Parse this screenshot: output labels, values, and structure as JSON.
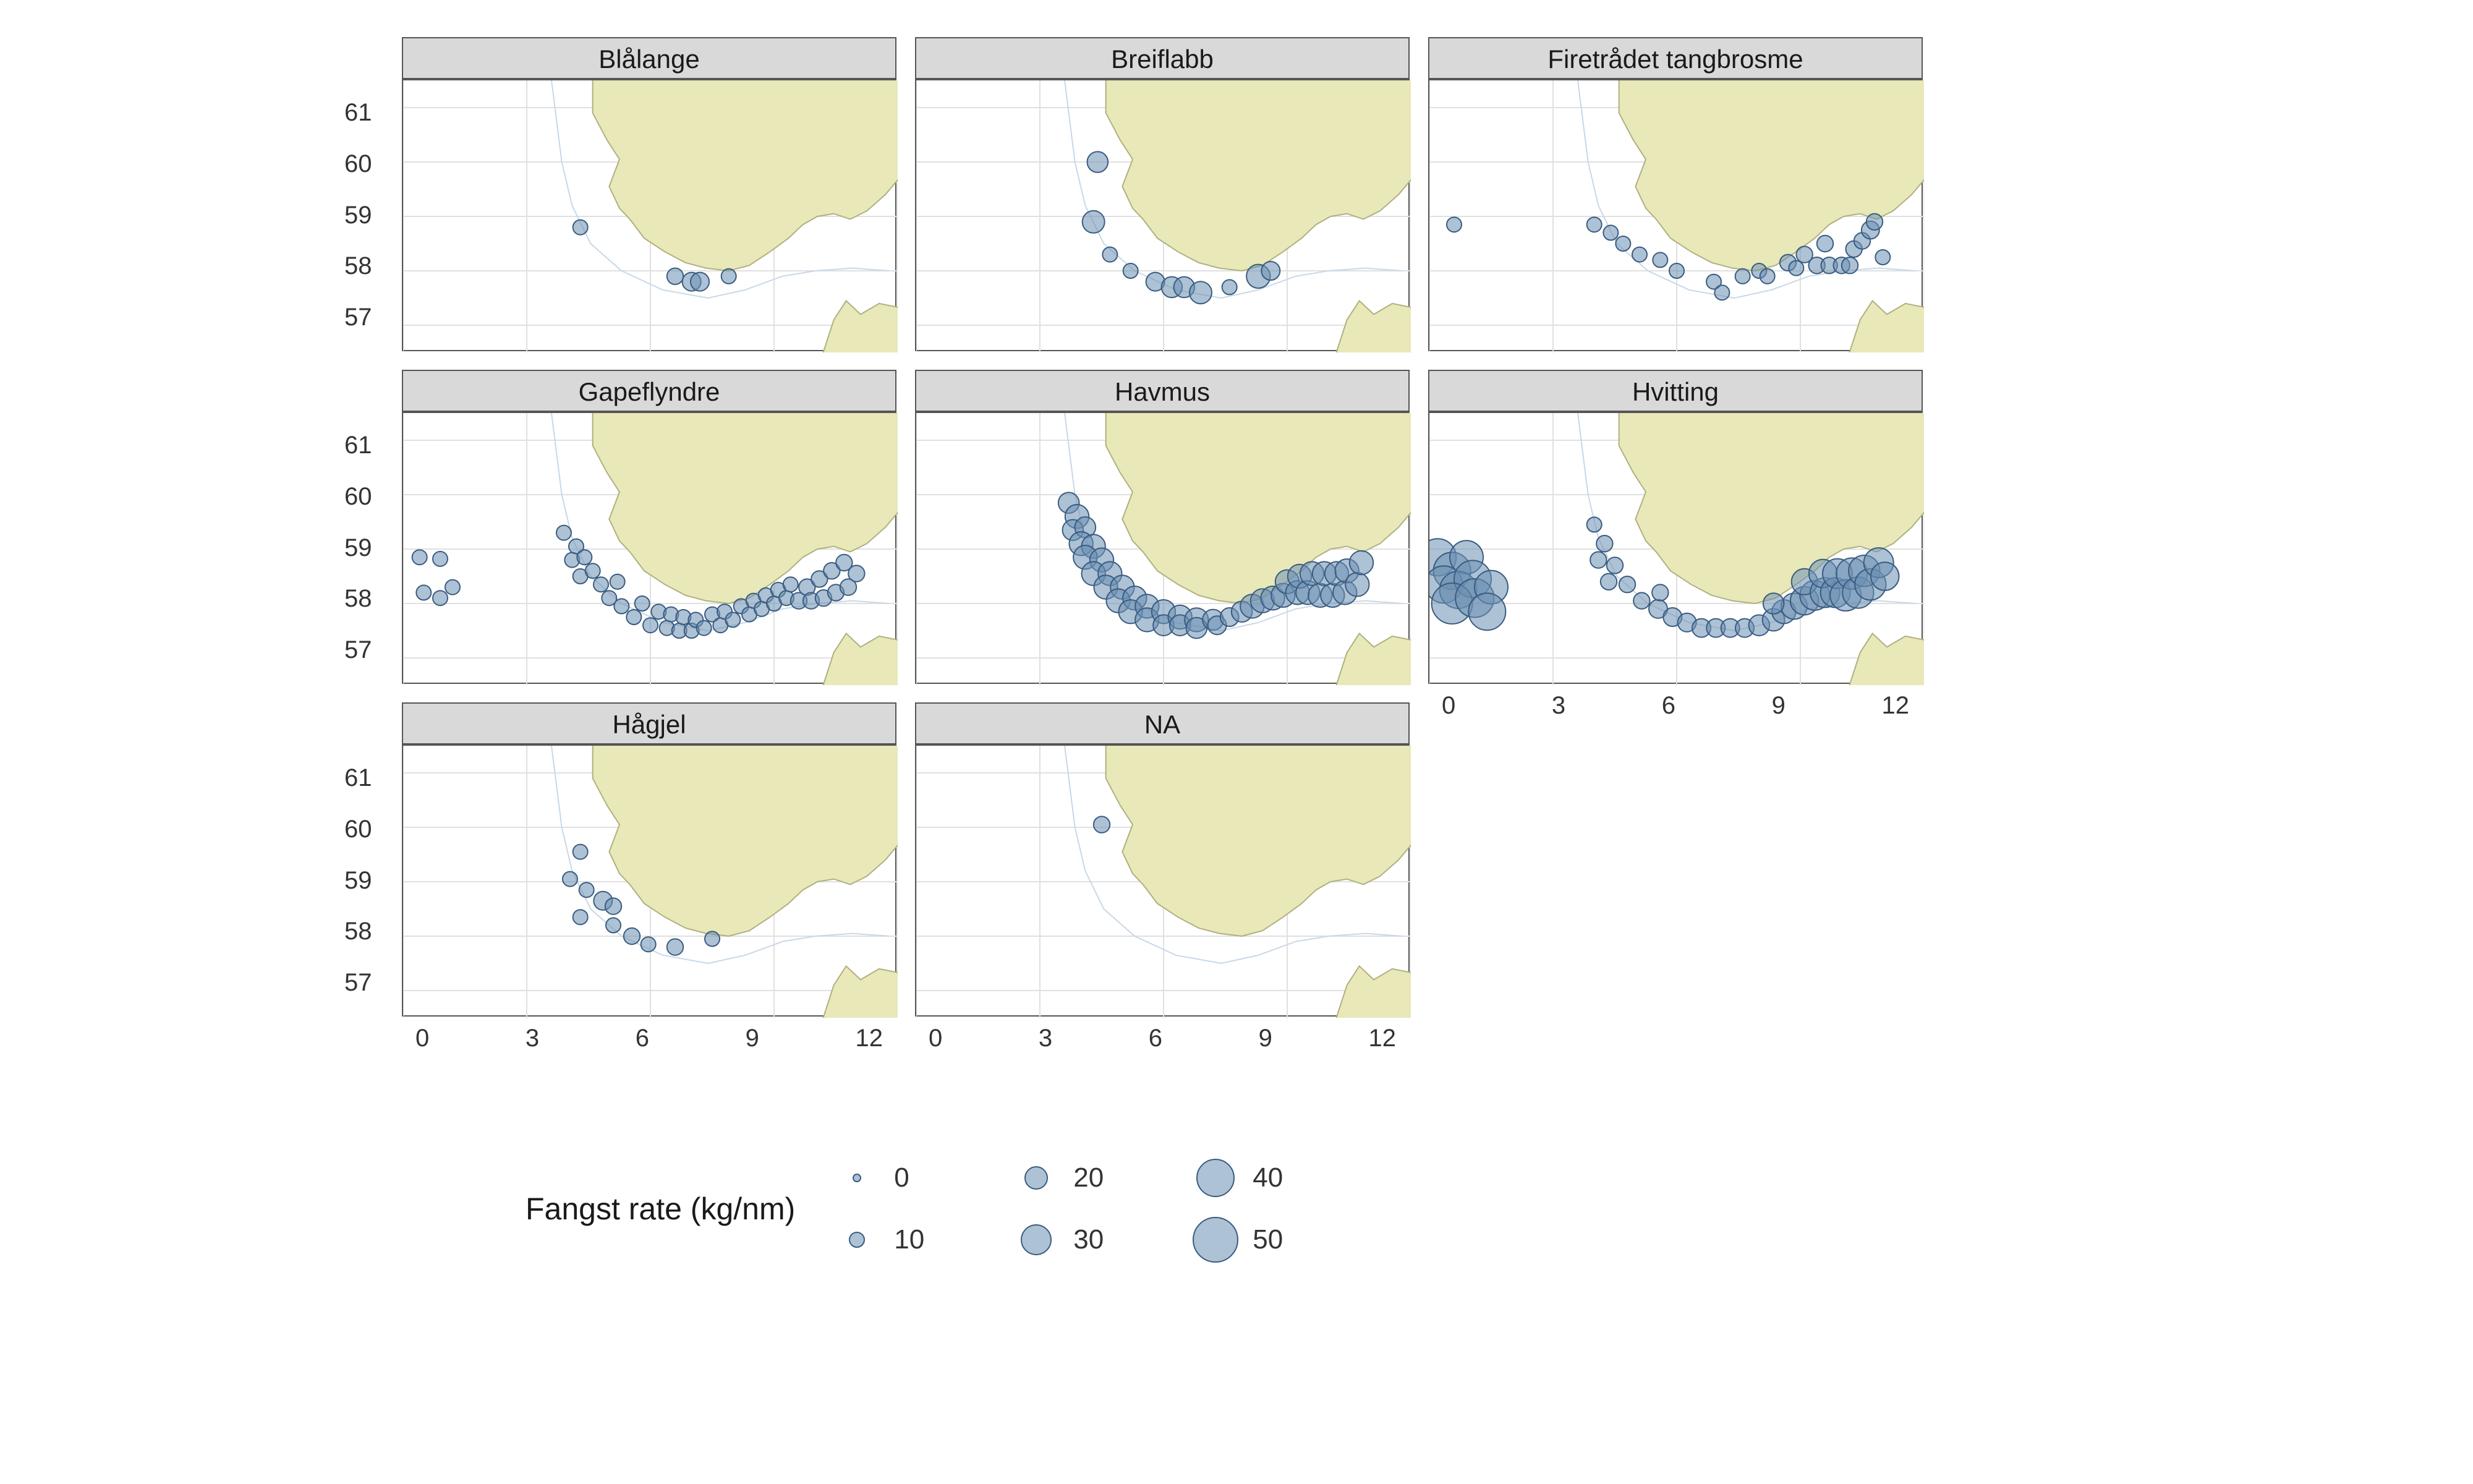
{
  "chart_data": {
    "type": "scatter",
    "legend_title": "Fangst rate (kg/nm)",
    "legend_values": [
      0,
      10,
      20,
      30,
      40,
      50
    ],
    "xlim": [
      0,
      12
    ],
    "ylim": [
      56.5,
      61.5
    ],
    "x_ticks": [
      0,
      3,
      6,
      9,
      12
    ],
    "y_ticks": [
      57,
      58,
      59,
      60,
      61
    ],
    "facets": [
      {
        "name": "Blålange",
        "points": [
          {
            "x": 4.3,
            "y": 58.8,
            "r": 10
          },
          {
            "x": 6.6,
            "y": 57.9,
            "r": 12
          },
          {
            "x": 7.0,
            "y": 57.8,
            "r": 15
          },
          {
            "x": 7.2,
            "y": 57.8,
            "r": 15
          },
          {
            "x": 7.9,
            "y": 57.9,
            "r": 10
          }
        ]
      },
      {
        "name": "Breiflabb",
        "points": [
          {
            "x": 4.4,
            "y": 60.0,
            "r": 18
          },
          {
            "x": 4.3,
            "y": 58.9,
            "r": 20
          },
          {
            "x": 4.7,
            "y": 58.3,
            "r": 10
          },
          {
            "x": 5.2,
            "y": 58.0,
            "r": 10
          },
          {
            "x": 5.8,
            "y": 57.8,
            "r": 15
          },
          {
            "x": 6.2,
            "y": 57.7,
            "r": 18
          },
          {
            "x": 6.5,
            "y": 57.7,
            "r": 18
          },
          {
            "x": 6.9,
            "y": 57.6,
            "r": 20
          },
          {
            "x": 7.6,
            "y": 57.7,
            "r": 10
          },
          {
            "x": 8.3,
            "y": 57.9,
            "r": 22
          },
          {
            "x": 8.6,
            "y": 58.0,
            "r": 15
          }
        ]
      },
      {
        "name": "Firetrådet tangbrosme",
        "points": [
          {
            "x": 0.6,
            "y": 58.85,
            "r": 10
          },
          {
            "x": 4.0,
            "y": 58.85,
            "r": 10
          },
          {
            "x": 4.4,
            "y": 58.7,
            "r": 10
          },
          {
            "x": 4.7,
            "y": 58.5,
            "r": 10
          },
          {
            "x": 5.1,
            "y": 58.3,
            "r": 10
          },
          {
            "x": 5.6,
            "y": 58.2,
            "r": 10
          },
          {
            "x": 6.0,
            "y": 58.0,
            "r": 10
          },
          {
            "x": 6.9,
            "y": 57.8,
            "r": 10
          },
          {
            "x": 7.1,
            "y": 57.6,
            "r": 10
          },
          {
            "x": 7.6,
            "y": 57.9,
            "r": 10
          },
          {
            "x": 8.0,
            "y": 58.0,
            "r": 10
          },
          {
            "x": 8.2,
            "y": 57.9,
            "r": 10
          },
          {
            "x": 8.7,
            "y": 58.15,
            "r": 12
          },
          {
            "x": 8.9,
            "y": 58.05,
            "r": 10
          },
          {
            "x": 9.1,
            "y": 58.3,
            "r": 12
          },
          {
            "x": 9.4,
            "y": 58.1,
            "r": 12
          },
          {
            "x": 9.6,
            "y": 58.5,
            "r": 12
          },
          {
            "x": 9.7,
            "y": 58.1,
            "r": 12
          },
          {
            "x": 10.0,
            "y": 58.1,
            "r": 12
          },
          {
            "x": 10.2,
            "y": 58.1,
            "r": 12
          },
          {
            "x": 10.3,
            "y": 58.4,
            "r": 12
          },
          {
            "x": 10.5,
            "y": 58.55,
            "r": 12
          },
          {
            "x": 10.7,
            "y": 58.75,
            "r": 14
          },
          {
            "x": 10.8,
            "y": 58.9,
            "r": 12
          },
          {
            "x": 11.0,
            "y": 58.25,
            "r": 10
          }
        ]
      },
      {
        "name": "Gapeflyndre",
        "points": [
          {
            "x": 0.4,
            "y": 58.85,
            "r": 10
          },
          {
            "x": 0.9,
            "y": 58.82,
            "r": 10
          },
          {
            "x": 0.5,
            "y": 58.2,
            "r": 10
          },
          {
            "x": 0.9,
            "y": 58.1,
            "r": 10
          },
          {
            "x": 1.2,
            "y": 58.3,
            "r": 10
          },
          {
            "x": 3.9,
            "y": 59.3,
            "r": 10
          },
          {
            "x": 4.2,
            "y": 59.05,
            "r": 10
          },
          {
            "x": 4.1,
            "y": 58.8,
            "r": 10
          },
          {
            "x": 4.4,
            "y": 58.85,
            "r": 10
          },
          {
            "x": 4.3,
            "y": 58.5,
            "r": 10
          },
          {
            "x": 4.6,
            "y": 58.6,
            "r": 10
          },
          {
            "x": 4.8,
            "y": 58.35,
            "r": 10
          },
          {
            "x": 5.0,
            "y": 58.1,
            "r": 10
          },
          {
            "x": 5.2,
            "y": 58.4,
            "r": 10
          },
          {
            "x": 5.3,
            "y": 57.95,
            "r": 10
          },
          {
            "x": 5.6,
            "y": 57.75,
            "r": 10
          },
          {
            "x": 5.8,
            "y": 58.0,
            "r": 10
          },
          {
            "x": 6.0,
            "y": 57.6,
            "r": 10
          },
          {
            "x": 6.2,
            "y": 57.85,
            "r": 10
          },
          {
            "x": 6.4,
            "y": 57.55,
            "r": 10
          },
          {
            "x": 6.5,
            "y": 57.8,
            "r": 10
          },
          {
            "x": 6.7,
            "y": 57.5,
            "r": 10
          },
          {
            "x": 6.8,
            "y": 57.75,
            "r": 10
          },
          {
            "x": 7.0,
            "y": 57.5,
            "r": 10
          },
          {
            "x": 7.1,
            "y": 57.7,
            "r": 10
          },
          {
            "x": 7.3,
            "y": 57.55,
            "r": 10
          },
          {
            "x": 7.5,
            "y": 57.8,
            "r": 10
          },
          {
            "x": 7.7,
            "y": 57.6,
            "r": 10
          },
          {
            "x": 7.8,
            "y": 57.85,
            "r": 10
          },
          {
            "x": 8.0,
            "y": 57.7,
            "r": 10
          },
          {
            "x": 8.2,
            "y": 57.95,
            "r": 10
          },
          {
            "x": 8.4,
            "y": 57.8,
            "r": 10
          },
          {
            "x": 8.5,
            "y": 58.05,
            "r": 10
          },
          {
            "x": 8.7,
            "y": 57.9,
            "r": 10
          },
          {
            "x": 8.8,
            "y": 58.15,
            "r": 10
          },
          {
            "x": 9.0,
            "y": 58.0,
            "r": 10
          },
          {
            "x": 9.1,
            "y": 58.25,
            "r": 10
          },
          {
            "x": 9.3,
            "y": 58.1,
            "r": 10
          },
          {
            "x": 9.4,
            "y": 58.35,
            "r": 10
          },
          {
            "x": 9.6,
            "y": 58.05,
            "r": 12
          },
          {
            "x": 9.8,
            "y": 58.3,
            "r": 12
          },
          {
            "x": 9.9,
            "y": 58.05,
            "r": 12
          },
          {
            "x": 10.1,
            "y": 58.45,
            "r": 12
          },
          {
            "x": 10.2,
            "y": 58.1,
            "r": 12
          },
          {
            "x": 10.4,
            "y": 58.6,
            "r": 12
          },
          {
            "x": 10.5,
            "y": 58.2,
            "r": 12
          },
          {
            "x": 10.7,
            "y": 58.75,
            "r": 12
          },
          {
            "x": 10.8,
            "y": 58.3,
            "r": 12
          },
          {
            "x": 11.0,
            "y": 58.55,
            "r": 12
          }
        ]
      },
      {
        "name": "Havmus",
        "points": [
          {
            "x": 3.7,
            "y": 59.85,
            "r": 18
          },
          {
            "x": 3.9,
            "y": 59.6,
            "r": 22
          },
          {
            "x": 3.8,
            "y": 59.35,
            "r": 18
          },
          {
            "x": 4.1,
            "y": 59.4,
            "r": 18
          },
          {
            "x": 4.0,
            "y": 59.1,
            "r": 22
          },
          {
            "x": 4.3,
            "y": 59.05,
            "r": 22
          },
          {
            "x": 4.1,
            "y": 58.85,
            "r": 22
          },
          {
            "x": 4.5,
            "y": 58.8,
            "r": 22
          },
          {
            "x": 4.3,
            "y": 58.55,
            "r": 22
          },
          {
            "x": 4.7,
            "y": 58.55,
            "r": 22
          },
          {
            "x": 4.6,
            "y": 58.3,
            "r": 22
          },
          {
            "x": 5.0,
            "y": 58.3,
            "r": 22
          },
          {
            "x": 4.9,
            "y": 58.05,
            "r": 22
          },
          {
            "x": 5.3,
            "y": 58.1,
            "r": 22
          },
          {
            "x": 5.2,
            "y": 57.85,
            "r": 22
          },
          {
            "x": 5.6,
            "y": 57.95,
            "r": 22
          },
          {
            "x": 5.6,
            "y": 57.7,
            "r": 22
          },
          {
            "x": 6.0,
            "y": 57.85,
            "r": 22
          },
          {
            "x": 6.0,
            "y": 57.6,
            "r": 18
          },
          {
            "x": 6.4,
            "y": 57.75,
            "r": 22
          },
          {
            "x": 6.4,
            "y": 57.6,
            "r": 18
          },
          {
            "x": 6.8,
            "y": 57.7,
            "r": 22
          },
          {
            "x": 6.8,
            "y": 57.55,
            "r": 18
          },
          {
            "x": 7.2,
            "y": 57.7,
            "r": 18
          },
          {
            "x": 7.3,
            "y": 57.6,
            "r": 15
          },
          {
            "x": 7.6,
            "y": 57.75,
            "r": 15
          },
          {
            "x": 7.9,
            "y": 57.85,
            "r": 18
          },
          {
            "x": 8.15,
            "y": 57.95,
            "r": 22
          },
          {
            "x": 8.4,
            "y": 58.05,
            "r": 22
          },
          {
            "x": 8.65,
            "y": 58.1,
            "r": 22
          },
          {
            "x": 8.9,
            "y": 58.15,
            "r": 22
          },
          {
            "x": 9.0,
            "y": 58.4,
            "r": 22
          },
          {
            "x": 9.25,
            "y": 58.2,
            "r": 22
          },
          {
            "x": 9.3,
            "y": 58.5,
            "r": 22
          },
          {
            "x": 9.5,
            "y": 58.2,
            "r": 22
          },
          {
            "x": 9.6,
            "y": 58.55,
            "r": 22
          },
          {
            "x": 9.8,
            "y": 58.15,
            "r": 22
          },
          {
            "x": 9.9,
            "y": 58.55,
            "r": 22
          },
          {
            "x": 10.1,
            "y": 58.15,
            "r": 22
          },
          {
            "x": 10.2,
            "y": 58.55,
            "r": 22
          },
          {
            "x": 10.4,
            "y": 58.2,
            "r": 22
          },
          {
            "x": 10.45,
            "y": 58.6,
            "r": 22
          },
          {
            "x": 10.7,
            "y": 58.35,
            "r": 22
          },
          {
            "x": 10.8,
            "y": 58.75,
            "r": 22
          }
        ]
      },
      {
        "name": "Hvitting",
        "points": [
          {
            "x": 0.2,
            "y": 58.85,
            "r": 40
          },
          {
            "x": 0.55,
            "y": 58.6,
            "r": 40
          },
          {
            "x": 0.9,
            "y": 58.85,
            "r": 35
          },
          {
            "x": 0.35,
            "y": 58.35,
            "r": 40
          },
          {
            "x": 0.7,
            "y": 58.25,
            "r": 40
          },
          {
            "x": 1.05,
            "y": 58.45,
            "r": 40
          },
          {
            "x": 0.55,
            "y": 58.0,
            "r": 45
          },
          {
            "x": 1.1,
            "y": 58.1,
            "r": 42
          },
          {
            "x": 1.5,
            "y": 58.3,
            "r": 35
          },
          {
            "x": 1.4,
            "y": 57.85,
            "r": 40
          },
          {
            "x": 4.0,
            "y": 59.45,
            "r": 10
          },
          {
            "x": 4.25,
            "y": 59.1,
            "r": 12
          },
          {
            "x": 4.1,
            "y": 58.8,
            "r": 12
          },
          {
            "x": 4.5,
            "y": 58.7,
            "r": 12
          },
          {
            "x": 4.35,
            "y": 58.4,
            "r": 12
          },
          {
            "x": 4.8,
            "y": 58.35,
            "r": 12
          },
          {
            "x": 5.15,
            "y": 58.05,
            "r": 12
          },
          {
            "x": 5.55,
            "y": 57.9,
            "r": 15
          },
          {
            "x": 5.9,
            "y": 57.75,
            "r": 15
          },
          {
            "x": 5.6,
            "y": 58.2,
            "r": 12
          },
          {
            "x": 6.25,
            "y": 57.65,
            "r": 15
          },
          {
            "x": 6.6,
            "y": 57.55,
            "r": 15
          },
          {
            "x": 6.95,
            "y": 57.55,
            "r": 15
          },
          {
            "x": 7.3,
            "y": 57.55,
            "r": 15
          },
          {
            "x": 7.65,
            "y": 57.55,
            "r": 15
          },
          {
            "x": 8.0,
            "y": 57.6,
            "r": 18
          },
          {
            "x": 8.35,
            "y": 57.7,
            "r": 20
          },
          {
            "x": 8.6,
            "y": 57.85,
            "r": 22
          },
          {
            "x": 8.85,
            "y": 57.95,
            "r": 25
          },
          {
            "x": 8.35,
            "y": 58.0,
            "r": 18
          },
          {
            "x": 9.1,
            "y": 58.05,
            "r": 28
          },
          {
            "x": 9.35,
            "y": 58.15,
            "r": 30
          },
          {
            "x": 9.1,
            "y": 58.4,
            "r": 25
          },
          {
            "x": 9.6,
            "y": 58.2,
            "r": 30
          },
          {
            "x": 9.55,
            "y": 58.55,
            "r": 28
          },
          {
            "x": 9.85,
            "y": 58.2,
            "r": 30
          },
          {
            "x": 9.9,
            "y": 58.55,
            "r": 30
          },
          {
            "x": 10.1,
            "y": 58.15,
            "r": 32
          },
          {
            "x": 10.25,
            "y": 58.55,
            "r": 32
          },
          {
            "x": 10.4,
            "y": 58.2,
            "r": 32
          },
          {
            "x": 10.55,
            "y": 58.6,
            "r": 32
          },
          {
            "x": 10.7,
            "y": 58.35,
            "r": 32
          },
          {
            "x": 10.9,
            "y": 58.75,
            "r": 30
          },
          {
            "x": 11.05,
            "y": 58.5,
            "r": 28
          }
        ]
      },
      {
        "name": "Hågjel",
        "points": [
          {
            "x": 4.3,
            "y": 59.55,
            "r": 10
          },
          {
            "x": 4.05,
            "y": 59.05,
            "r": 10
          },
          {
            "x": 4.45,
            "y": 58.85,
            "r": 10
          },
          {
            "x": 4.3,
            "y": 58.35,
            "r": 10
          },
          {
            "x": 4.85,
            "y": 58.65,
            "r": 15
          },
          {
            "x": 5.1,
            "y": 58.55,
            "r": 12
          },
          {
            "x": 5.1,
            "y": 58.2,
            "r": 10
          },
          {
            "x": 5.55,
            "y": 58.0,
            "r": 12
          },
          {
            "x": 5.95,
            "y": 57.85,
            "r": 10
          },
          {
            "x": 6.6,
            "y": 57.8,
            "r": 12
          },
          {
            "x": 7.5,
            "y": 57.95,
            "r": 10
          }
        ]
      },
      {
        "name": "NA",
        "points": [
          {
            "x": 4.5,
            "y": 60.05,
            "r": 12
          }
        ]
      }
    ]
  }
}
